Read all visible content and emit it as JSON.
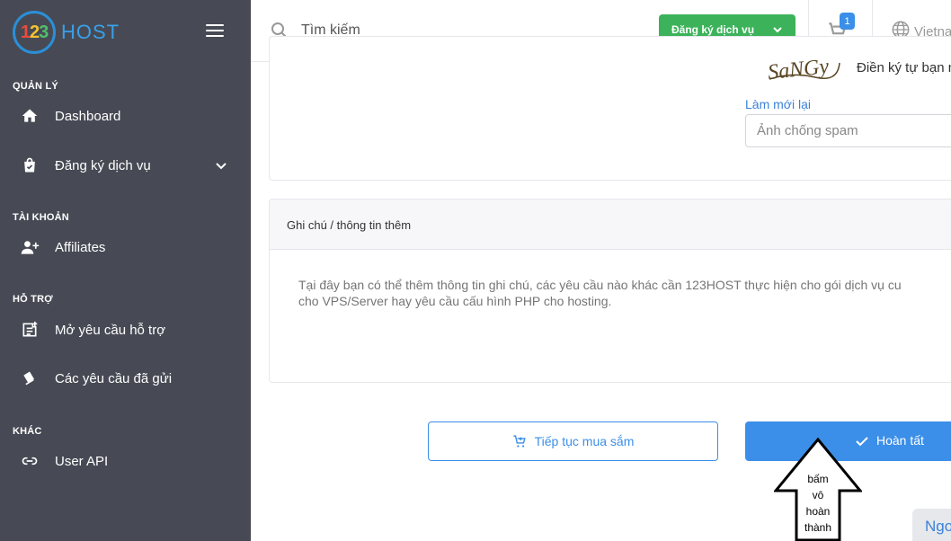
{
  "sidebar": {
    "logo": {
      "digits": [
        "1",
        "2",
        "3"
      ],
      "text": "HOST"
    },
    "sections": [
      {
        "title": "QUẢN LÝ"
      },
      {
        "title": "TÀI KHOẢN"
      },
      {
        "title": "HỖ TRỢ"
      },
      {
        "title": "KHÁC"
      }
    ],
    "items": [
      {
        "label": "Dashboard",
        "icon": "home-icon"
      },
      {
        "label": "Đăng ký dịch vụ",
        "icon": "shopping-bag-icon"
      },
      {
        "label": "Affiliates",
        "icon": "add-user-icon"
      },
      {
        "label": "Mở yêu cầu hỗ trợ",
        "icon": "new-ticket-icon"
      },
      {
        "label": "Các yêu cầu đã gửi",
        "icon": "tickets-icon"
      },
      {
        "label": "User API",
        "icon": "link-icon"
      }
    ]
  },
  "header": {
    "search_placeholder": "Tìm kiếm",
    "register_button": "Đăng ký dịch vụ",
    "cart_count": "1",
    "language": "Vietna"
  },
  "captcha": {
    "image_text": "SaNGy",
    "hint": "Điền ký tự bạn n",
    "refresh": "Làm mới lại",
    "placeholder": "Ảnh chống spam"
  },
  "notes": {
    "title": "Ghi chú / thông tin thêm",
    "placeholder": "Tại đây bạn có thể thêm thông tin ghi chú, các yêu cầu nào khác cần 123HOST thực hiện cho gói dịch vụ cu\ncho VPS/Server hay yêu cầu cấu hình PHP cho hosting."
  },
  "actions": {
    "continue": "Tiếp tục mua sắm",
    "finish": "Hoàn tất"
  },
  "annotation": {
    "lines": [
      "bấm",
      "vô",
      "hoàn",
      "thành"
    ]
  },
  "language_tab": "Ngo",
  "colors": {
    "sidebar_bg": "#474a54",
    "primary": "#3b8fe8",
    "success": "#3cb35a"
  }
}
